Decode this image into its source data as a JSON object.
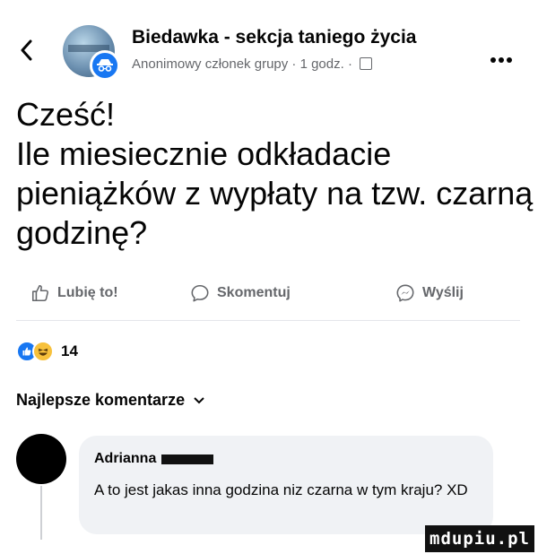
{
  "header": {
    "back_glyph": "<",
    "group_name": "Biedawka - sekcja taniego życia",
    "subtitle": "Anonimowy członek grupy · 1 godz. ·",
    "more_glyph": "...",
    "icons": {
      "back": "chevron-left-icon",
      "more": "more-options-icon",
      "visibility": "group-visibility-icon"
    }
  },
  "post": {
    "lines": [
      "Cześć!",
      "Ile miesiecznie odkładacie",
      "pieniążków z wypłaty na tzw. czarną",
      "godzinę?"
    ]
  },
  "actions": {
    "like_label": "Lubię to!",
    "comment_label": "Skomentuj",
    "send_label": "Wyślij"
  },
  "reactions": {
    "count": "14",
    "types": [
      "like",
      "haha"
    ]
  },
  "comments_section": {
    "sort_label": "Najlepsze komentarze"
  },
  "comment": {
    "author": "Adrianna",
    "text": "A to jest jakas inna godzina niz czarna w tym kraju? XD"
  },
  "watermark": {
    "text": "mdupiu.pl"
  },
  "colors": {
    "accent": "#1877f2",
    "secondary_text": "#65676b",
    "bubble": "#f0f2f5"
  }
}
